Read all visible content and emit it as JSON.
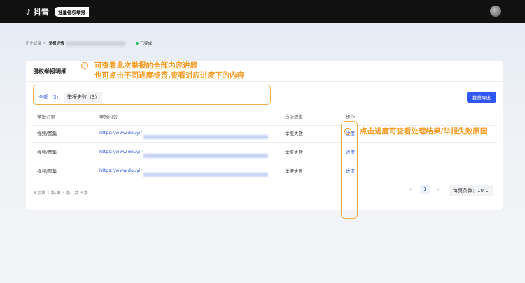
{
  "header": {
    "logo": "抖音",
    "badge": "批量侵权举报"
  },
  "breadcrumb": {
    "items": [
      "历史记录",
      "举报详情"
    ],
    "separator": ">",
    "status": "已完成"
  },
  "card": {
    "title": "侵权举报明细",
    "export_label": "批量导出",
    "tabs": [
      {
        "label": "全部（3）",
        "active": true
      },
      {
        "label": "举报失败（3）",
        "active": false
      }
    ],
    "columns": [
      "举报对象",
      "举报内容",
      "当前进度",
      "操作"
    ],
    "rows": [
      {
        "target": "视频/图集",
        "content": "https://www.douyir",
        "status": "举报失败",
        "action": "进度"
      },
      {
        "target": "视频/图集",
        "content": "https://www.douyir",
        "status": "举报失败",
        "action": "进度"
      },
      {
        "target": "视频/图集",
        "content": "https://www.douyir",
        "status": "举报失败",
        "action": "进度"
      }
    ],
    "footer": "显示第 1 条-第 3 条，共 3 条",
    "pagination": {
      "prev": "‹",
      "page": "1",
      "next": "›",
      "page_size": "每页条数：10 ⌄"
    }
  },
  "annotations": {
    "line1": "可查看此次举报的全部内容进展",
    "line2": "也可点击不同进度标签,查看对应进度下的内容",
    "line3": "点击进度可查看处理结果/举报失败原因"
  },
  "colors": {
    "accent": "#3056f5",
    "annotation": "#f39a23",
    "status_dot": "#2cbf5a"
  }
}
